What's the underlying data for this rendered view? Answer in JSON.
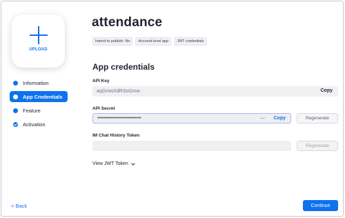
{
  "upload": {
    "label": "UPLOAD"
  },
  "sidebar": {
    "items": [
      {
        "label": "Information",
        "icon": "dot-icon"
      },
      {
        "label": "App Credentials",
        "icon": "dot-icon",
        "active": true
      },
      {
        "label": "Feature",
        "icon": "dot-icon"
      },
      {
        "label": "Activation",
        "icon": "check-circle-icon"
      }
    ],
    "back_label": "< Back"
  },
  "header": {
    "title": "attendance",
    "tags": [
      "Intend to publish: No",
      "Account-level app",
      "JWT credentials"
    ]
  },
  "credentials": {
    "section_title": "App credentials",
    "api_key": {
      "label": "API Key",
      "value": "aqGmwXdRSoGmw",
      "copy_label": "Copy"
    },
    "api_secret": {
      "label": "API Secret",
      "value": "••••••••••••••••••••••••••",
      "copy_label": "Copy",
      "regenerate_label": "Regenerate"
    },
    "im_token": {
      "label": "IM Chat History Token",
      "value": "",
      "regenerate_label": "Regenerate"
    },
    "view_jwt_label": "View JWT Token"
  },
  "footer": {
    "continue_label": "Continue"
  },
  "colors": {
    "accent": "#0e72ed"
  }
}
